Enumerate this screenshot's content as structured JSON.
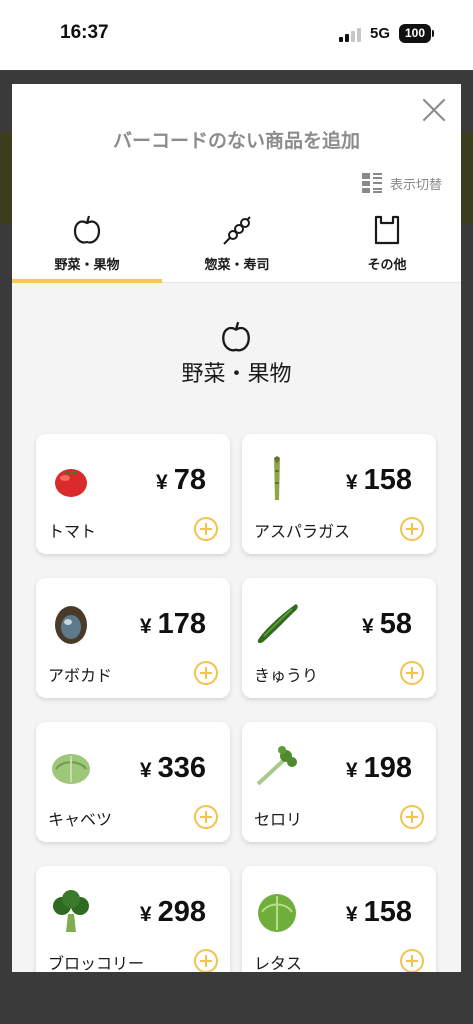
{
  "status": {
    "time": "16:37",
    "network": "5G",
    "battery": "100"
  },
  "modal": {
    "title": "バーコードのない商品を追加",
    "view_toggle_label": "表示切替",
    "tabs": [
      {
        "label": "野菜・果物",
        "icon": "apple-icon",
        "active": true
      },
      {
        "label": "惣菜・寿司",
        "icon": "skewer-icon",
        "active": false
      },
      {
        "label": "その他",
        "icon": "bag-icon",
        "active": false
      }
    ],
    "category": {
      "title": "野菜・果物",
      "icon": "apple-icon"
    },
    "currency": "¥",
    "items": [
      {
        "name": "トマト",
        "price": "78",
        "icon": "tomato-icon"
      },
      {
        "name": "アスパラガス",
        "price": "158",
        "icon": "asparagus-icon"
      },
      {
        "name": "アボカド",
        "price": "178",
        "icon": "avocado-icon"
      },
      {
        "name": "きゅうり",
        "price": "58",
        "icon": "cucumber-icon"
      },
      {
        "name": "キャベツ",
        "price": "336",
        "icon": "cabbage-icon"
      },
      {
        "name": "セロリ",
        "price": "198",
        "icon": "celery-icon"
      },
      {
        "name": "ブロッコリー",
        "price": "298",
        "icon": "broccoli-icon"
      },
      {
        "name": "レタス",
        "price": "158",
        "icon": "lettuce-icon"
      }
    ]
  },
  "colors": {
    "accent": "#f6c656",
    "add_icon": "#f3c24e",
    "modal_bg": "#f4f4f4",
    "overlay": "#3a3a3a"
  }
}
